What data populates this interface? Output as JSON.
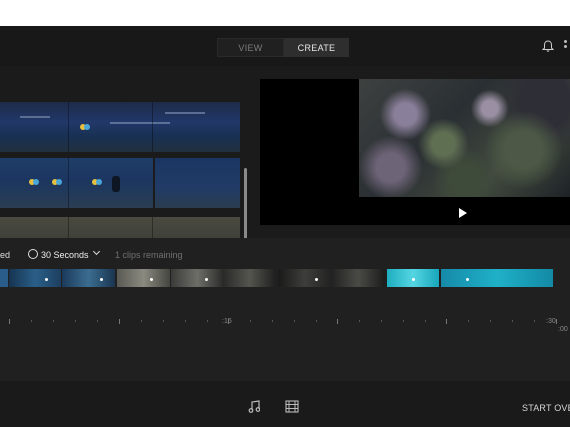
{
  "header": {
    "tabs": [
      {
        "label": "VIEW",
        "active": false
      },
      {
        "label": "CREATE",
        "active": true
      }
    ],
    "icons": [
      "bell-icon",
      "more-icon"
    ]
  },
  "controls": {
    "used_label": "ed",
    "duration_label": "30 Seconds",
    "clips_remaining": "1 clips remaining",
    "icons": [
      "clock-icon",
      "chevron-down-icon"
    ]
  },
  "timeline": {
    "labels": [
      ":15",
      ":30",
      ":00"
    ]
  },
  "footer": {
    "start_over": "START OVE",
    "icons": [
      "music-icon",
      "filmstrip-icon"
    ]
  },
  "colors": {
    "accent_teal": "#1eaec0",
    "play": "#ffffff"
  }
}
